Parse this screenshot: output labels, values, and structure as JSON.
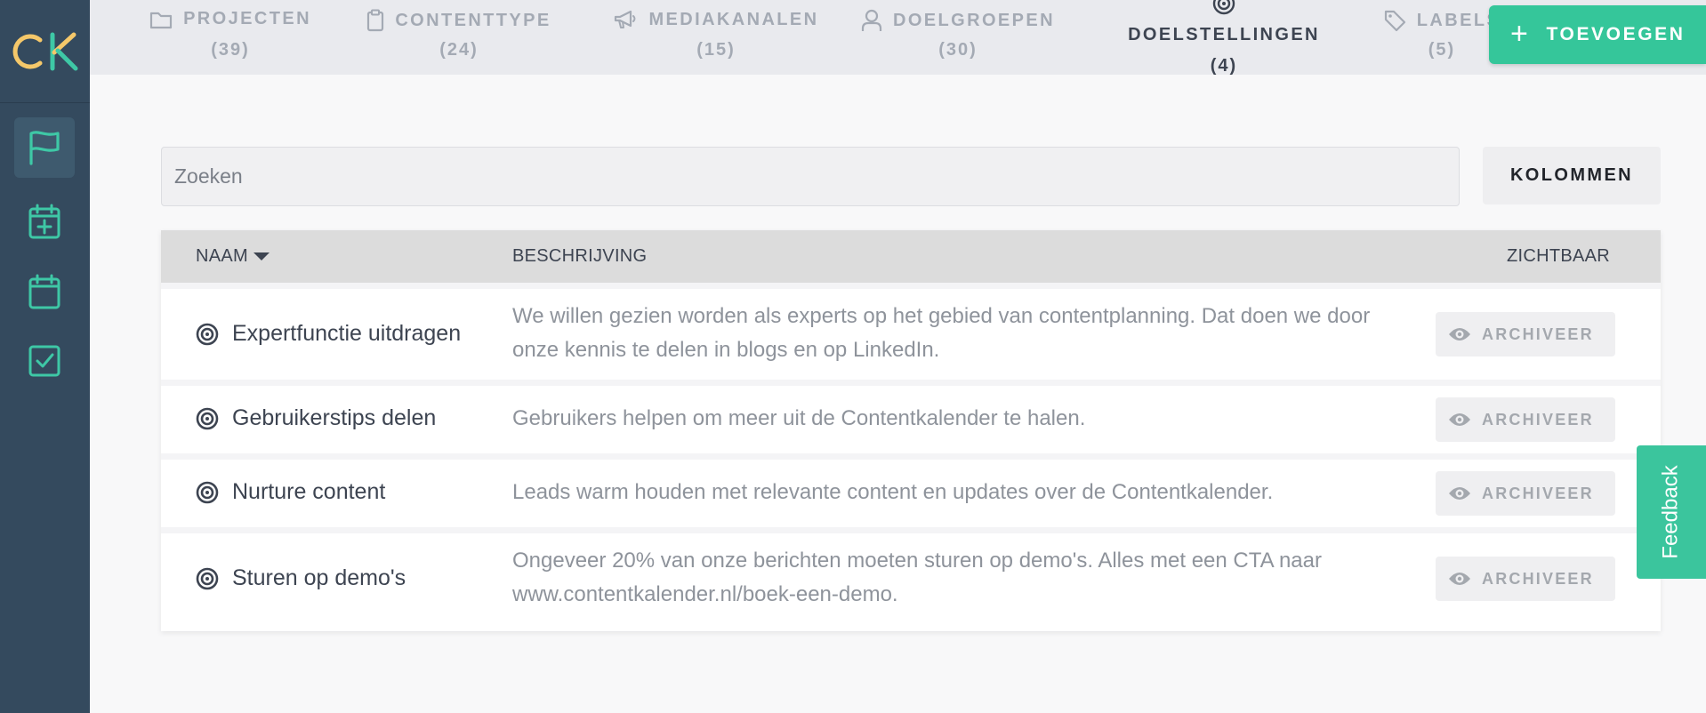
{
  "app": {
    "logo_text": "CK"
  },
  "colors": {
    "accent": "#35c69a",
    "sidebar": "#344a5e",
    "sidebar_icon": "#3ec8a6"
  },
  "sidebar": {
    "items": [
      {
        "icon": "flag-icon",
        "active": true
      },
      {
        "icon": "calendar-plus-icon",
        "active": false
      },
      {
        "icon": "calendar-icon",
        "active": false
      },
      {
        "icon": "checkbox-icon",
        "active": false
      }
    ]
  },
  "tabs": [
    {
      "label": "PROJECTEN",
      "count": "(39)",
      "icon": "folder-icon"
    },
    {
      "label": "CONTENTTYPE",
      "count": "(24)",
      "icon": "clipboard-icon"
    },
    {
      "label": "MEDIAKANALEN",
      "count": "(15)",
      "icon": "megaphone-icon"
    },
    {
      "label": "DOELGROEPEN",
      "count": "(30)",
      "icon": "user-icon"
    },
    {
      "label": "DOELSTELLINGEN",
      "count": "(4)",
      "icon": "target-icon",
      "active": true
    },
    {
      "label": "LABELS",
      "count": "(5)",
      "icon": "tag-icon"
    }
  ],
  "toolbar": {
    "add_label": "TOEVOEGEN",
    "columns_label": "KOLOMMEN"
  },
  "search": {
    "placeholder": "Zoeken",
    "value": ""
  },
  "table": {
    "headers": {
      "name": "NAAM",
      "description": "BESCHRIJVING",
      "visible": "ZICHTBAAR"
    },
    "rows": [
      {
        "name": "Expertfunctie uitdragen",
        "description": "We willen gezien worden als experts op het gebied van contentplanning. Dat doen we door onze kennis te delen in blogs en op LinkedIn.",
        "action": "ARCHIVEER"
      },
      {
        "name": "Gebruikerstips delen",
        "description": "Gebruikers helpen om meer uit de Contentkalender te halen.",
        "action": "ARCHIVEER"
      },
      {
        "name": "Nurture content",
        "description": "Leads warm houden met relevante content en updates over de Contentkalender.",
        "action": "ARCHIVEER"
      },
      {
        "name": "Sturen op demo's",
        "description": "Ongeveer 20% van onze berichten moeten sturen op demo's. Alles met een CTA naar www.contentkalender.nl/boek-een-demo.",
        "action": "ARCHIVEER"
      }
    ]
  },
  "feedback": {
    "label": "Feedback"
  }
}
